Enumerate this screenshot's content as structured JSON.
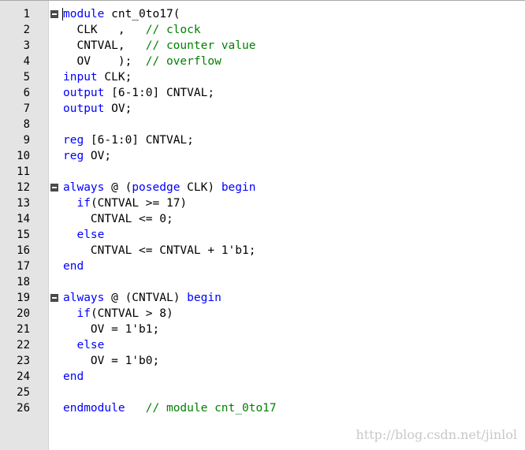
{
  "editor": {
    "lines": [
      {
        "n": "1",
        "fold": true,
        "tokens": [
          {
            "t": "kw",
            "v": "module"
          },
          {
            "t": "tx",
            "v": " cnt_0to17("
          }
        ]
      },
      {
        "n": "2",
        "fold": false,
        "tokens": [
          {
            "t": "tx",
            "v": "  CLK   ,   "
          },
          {
            "t": "cm",
            "v": "// clock"
          }
        ]
      },
      {
        "n": "3",
        "fold": false,
        "tokens": [
          {
            "t": "tx",
            "v": "  CNTVAL,   "
          },
          {
            "t": "cm",
            "v": "// counter value"
          }
        ]
      },
      {
        "n": "4",
        "fold": false,
        "tokens": [
          {
            "t": "tx",
            "v": "  OV    );  "
          },
          {
            "t": "cm",
            "v": "// overflow"
          }
        ]
      },
      {
        "n": "5",
        "fold": false,
        "tokens": [
          {
            "t": "kw",
            "v": "input"
          },
          {
            "t": "tx",
            "v": " CLK;"
          }
        ]
      },
      {
        "n": "6",
        "fold": false,
        "tokens": [
          {
            "t": "kw",
            "v": "output"
          },
          {
            "t": "tx",
            "v": " [6-1:0] CNTVAL;"
          }
        ]
      },
      {
        "n": "7",
        "fold": false,
        "tokens": [
          {
            "t": "kw",
            "v": "output"
          },
          {
            "t": "tx",
            "v": " OV;"
          }
        ]
      },
      {
        "n": "8",
        "fold": false,
        "tokens": []
      },
      {
        "n": "9",
        "fold": false,
        "tokens": [
          {
            "t": "kw",
            "v": "reg"
          },
          {
            "t": "tx",
            "v": " [6-1:0] CNTVAL;"
          }
        ]
      },
      {
        "n": "10",
        "fold": false,
        "tokens": [
          {
            "t": "kw",
            "v": "reg"
          },
          {
            "t": "tx",
            "v": " OV;"
          }
        ]
      },
      {
        "n": "11",
        "fold": false,
        "tokens": []
      },
      {
        "n": "12",
        "fold": true,
        "tokens": [
          {
            "t": "kw",
            "v": "always"
          },
          {
            "t": "tx",
            "v": " @ ("
          },
          {
            "t": "kw",
            "v": "posedge"
          },
          {
            "t": "tx",
            "v": " CLK) "
          },
          {
            "t": "kw",
            "v": "begin"
          }
        ]
      },
      {
        "n": "13",
        "fold": false,
        "tokens": [
          {
            "t": "tx",
            "v": "  "
          },
          {
            "t": "kw",
            "v": "if"
          },
          {
            "t": "tx",
            "v": "(CNTVAL >= 17)"
          }
        ]
      },
      {
        "n": "14",
        "fold": false,
        "tokens": [
          {
            "t": "tx",
            "v": "    CNTVAL <= 0;"
          }
        ]
      },
      {
        "n": "15",
        "fold": false,
        "tokens": [
          {
            "t": "tx",
            "v": "  "
          },
          {
            "t": "kw",
            "v": "else"
          }
        ]
      },
      {
        "n": "16",
        "fold": false,
        "tokens": [
          {
            "t": "tx",
            "v": "    CNTVAL <= CNTVAL + 1'b1;"
          }
        ]
      },
      {
        "n": "17",
        "fold": false,
        "tokens": [
          {
            "t": "kw",
            "v": "end"
          }
        ]
      },
      {
        "n": "18",
        "fold": false,
        "tokens": []
      },
      {
        "n": "19",
        "fold": true,
        "tokens": [
          {
            "t": "kw",
            "v": "always"
          },
          {
            "t": "tx",
            "v": " @ (CNTVAL) "
          },
          {
            "t": "kw",
            "v": "begin"
          }
        ]
      },
      {
        "n": "20",
        "fold": false,
        "tokens": [
          {
            "t": "tx",
            "v": "  "
          },
          {
            "t": "kw",
            "v": "if"
          },
          {
            "t": "tx",
            "v": "(CNTVAL > 8)"
          }
        ]
      },
      {
        "n": "21",
        "fold": false,
        "tokens": [
          {
            "t": "tx",
            "v": "    OV = 1'b1;"
          }
        ]
      },
      {
        "n": "22",
        "fold": false,
        "tokens": [
          {
            "t": "tx",
            "v": "  "
          },
          {
            "t": "kw",
            "v": "else"
          }
        ]
      },
      {
        "n": "23",
        "fold": false,
        "tokens": [
          {
            "t": "tx",
            "v": "    OV = 1'b0;"
          }
        ]
      },
      {
        "n": "24",
        "fold": false,
        "tokens": [
          {
            "t": "kw",
            "v": "end"
          }
        ]
      },
      {
        "n": "25",
        "fold": false,
        "tokens": []
      },
      {
        "n": "26",
        "fold": false,
        "tokens": [
          {
            "t": "kw",
            "v": "endmodule"
          },
          {
            "t": "tx",
            "v": "   "
          },
          {
            "t": "cm",
            "v": "// module cnt_0to17"
          }
        ]
      }
    ]
  },
  "colors": {
    "keyword": "#0000ff",
    "comment": "#008000",
    "text": "#000000",
    "gutter": "#e4e4e4"
  },
  "watermark": "http://blog.csdn.net/jinlol"
}
